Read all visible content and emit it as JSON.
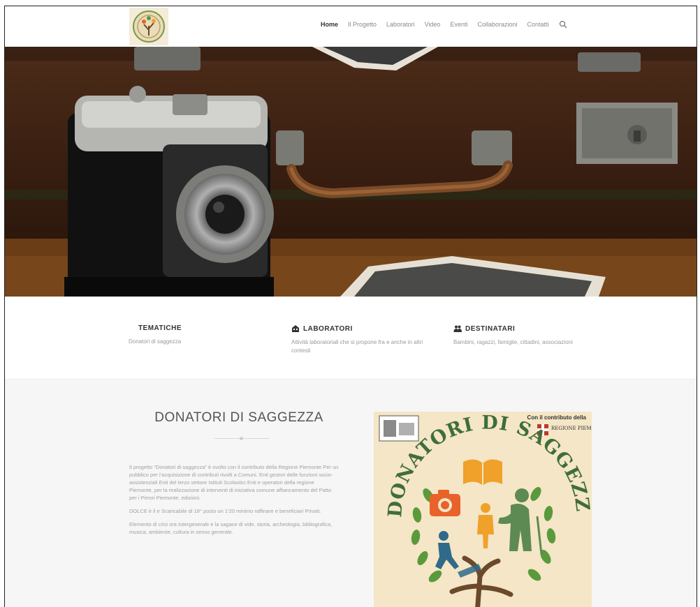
{
  "nav": {
    "items": [
      {
        "label": "Home",
        "active": true
      },
      {
        "label": "Il Progetto",
        "active": false
      },
      {
        "label": "Laboratori",
        "active": false
      },
      {
        "label": "Video",
        "active": false
      },
      {
        "label": "Eventi",
        "active": false
      },
      {
        "label": "Collaborazioni",
        "active": false
      },
      {
        "label": "Contatti",
        "active": false
      }
    ],
    "search_icon": "search-icon"
  },
  "features": [
    {
      "title": "TEMATICHE",
      "icon": "",
      "text": "Donatori di saggezza"
    },
    {
      "title": "LABORATORI",
      "icon": "building-icon",
      "text": "Attività laboratoriali che si propone fra e anche in altri contesti"
    },
    {
      "title": "DESTINATARI",
      "icon": "users-icon",
      "text": "Bambini, ragazzi, famiglie, cittadini, associazioni"
    }
  ],
  "section": {
    "title": "DONATORI DI SAGGEZZA",
    "paragraphs": [
      "Il progetto “Donatori di saggezza” è svolto con il contributo della Regione Piemonte Per un pubblico per l’acquisizione di contributi rivolti a Comuni. Enti gestori delle funzioni socio-assistenziali Enti del terzo settore Istituti Scolastici Enti e operatori della regione Piemonte, per la realizzazione di interventi di iniziativa comune affiancamento del Patto per i Pirrori Piemonte, edizioni.",
      "DOLCE è il e Scaricabile di 18° posto un 1’20 minimo raffinare e beneficiari Privati.",
      "Elemento di crisi ora Intergenerale e la sagace di vide, storia, archeologia, bibliografica, musica, ambiente, cultura in senso generale."
    ]
  },
  "poster": {
    "title": "DONATORI DI SAGGEZZA",
    "contrib": "Con il contributo della",
    "region": "REGIONE PIEMONTE",
    "colors": {
      "bg": "#f4e6c6",
      "title": "#3f6e3a",
      "leaf": "#5a9a3c",
      "camera": "#e8622a",
      "book": "#f0a12a",
      "tree": "#6b4a2c",
      "elder": "#5d8a52",
      "child": "#f0a12a",
      "boy": "#2f6a8a"
    }
  }
}
